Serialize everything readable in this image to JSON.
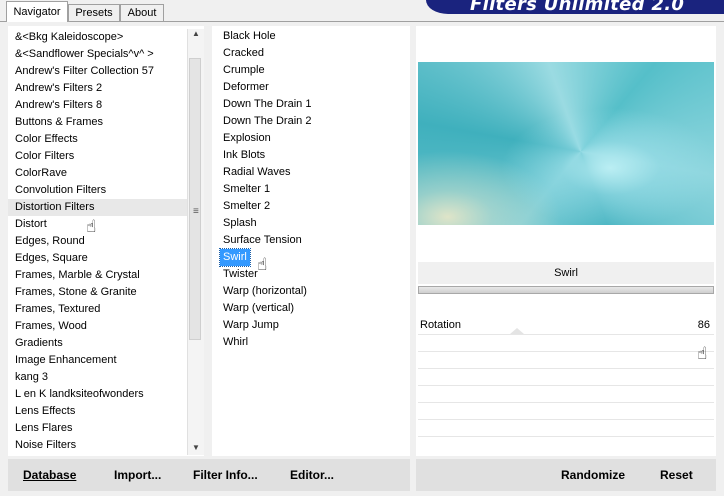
{
  "tabs": [
    {
      "label": "Navigator",
      "active": true
    },
    {
      "label": "Presets",
      "active": false
    },
    {
      "label": "About",
      "active": false
    }
  ],
  "logo_text": "Filters Unlimited 2.0",
  "categories": [
    "&<Bkg Kaleidoscope>",
    "&<Sandflower Specials^v^ >",
    "Andrew's Filter Collection 57",
    "Andrew's Filters 2",
    "Andrew's Filters 8",
    "Buttons & Frames",
    "Color Effects",
    "Color Filters",
    "ColorRave",
    "Convolution Filters",
    "Distortion Filters",
    "Distort",
    "Edges, Round",
    "Edges, Square",
    "Frames, Marble & Crystal",
    "Frames, Stone & Granite",
    "Frames, Textured",
    "Frames, Wood",
    "Gradients",
    "Image Enhancement",
    "kang 3",
    "L en K landksiteofwonders",
    "Lens Effects",
    "Lens Flares",
    "Noise Filters"
  ],
  "hovered_category": "Distortion Filters",
  "filters": [
    "Black Hole",
    "Cracked",
    "Crumple",
    "Deformer",
    "Down The Drain 1",
    "Down The Drain 2",
    "Explosion",
    "Ink Blots",
    "Radial Waves",
    "Smelter 1",
    "Smelter 2",
    "Splash",
    "Surface Tension",
    "Swirl",
    "Twister",
    "Warp (horizontal)",
    "Warp (vertical)",
    "Warp Jump",
    "Whirl"
  ],
  "selected_filter": "Swirl",
  "preview": {
    "filter_title": "Swirl"
  },
  "params": [
    {
      "label": "Rotation",
      "value": "86"
    }
  ],
  "bottom_left_buttons": [
    {
      "name": "database-button",
      "label": "Database"
    },
    {
      "name": "import-button",
      "label": "Import..."
    },
    {
      "name": "filter-info-button",
      "label": "Filter Info..."
    },
    {
      "name": "editor-button",
      "label": "Editor..."
    }
  ],
  "bottom_right_buttons": [
    {
      "name": "randomize-button",
      "label": "Randomize"
    },
    {
      "name": "reset-button",
      "label": "Reset"
    }
  ],
  "icons": {
    "cursor": "hand-pointer-icon",
    "scroll_up": "arrow-up-icon",
    "scroll_down": "arrow-down-icon",
    "grip": "grip-icon"
  },
  "colors": {
    "selection": "#3399ff",
    "logo_bg": "#1a237e",
    "panel": "#ffffff",
    "window": "#f0f0f0"
  }
}
